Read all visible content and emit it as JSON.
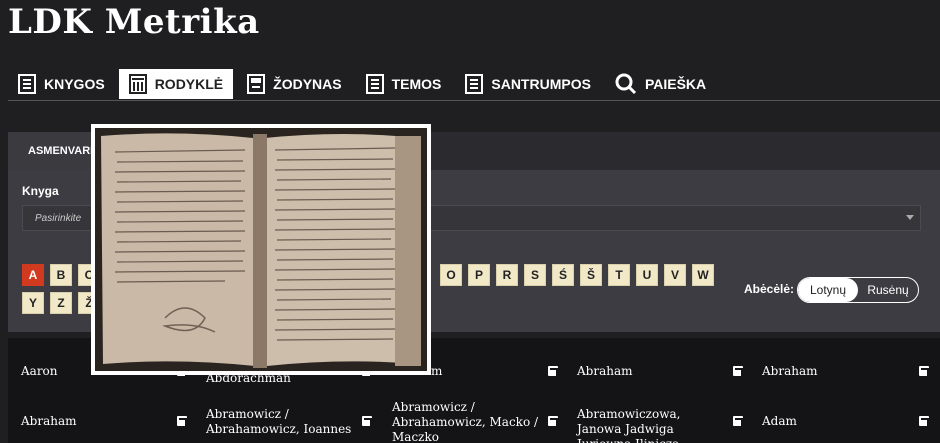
{
  "site": {
    "title": "LDK Metrika"
  },
  "nav": {
    "items": [
      {
        "label": "KNYGOS",
        "icon": "book-icon"
      },
      {
        "label": "RODYKLĖ",
        "icon": "index-icon"
      },
      {
        "label": "ŽODYNAS",
        "icon": "dictionary-icon"
      },
      {
        "label": "TEMOS",
        "icon": "book-icon"
      },
      {
        "label": "SANTRUMPOS",
        "icon": "book-icon"
      },
      {
        "label": "PAIEŠKA",
        "icon": "search-icon"
      }
    ]
  },
  "panel": {
    "tab_label": "ASMENVARD",
    "book_label": "Knyga",
    "book_placeholder": "Pasirinkite"
  },
  "alphabet": {
    "row1_left": [
      "A",
      "B",
      "C"
    ],
    "row1_right": [
      "O",
      "P",
      "R",
      "S",
      "Ś",
      "Š",
      "T",
      "U",
      "V",
      "W"
    ],
    "row2": [
      "Y",
      "Z",
      "Ž"
    ],
    "active": "A",
    "label": "Abėcėlė:",
    "options": [
      "Lotynų",
      "Rusėnų"
    ],
    "selected": "Lotynų"
  },
  "results": {
    "row1": [
      "Aaron",
      "Abdorachman",
      "m",
      "Abraham",
      "Abraham"
    ],
    "row2": [
      "Abraham",
      "Abramowicz / Abrahamowicz, Ioannes",
      "Abramowicz / Abrahamowicz, Macko / Maczko",
      "Abramowiczowa, Janowa Jadwiga Juriewna Ilinicza",
      "Adam"
    ]
  },
  "colors": {
    "active_letter": "#d23a1f",
    "letter_bg": "#f1e8c8"
  }
}
